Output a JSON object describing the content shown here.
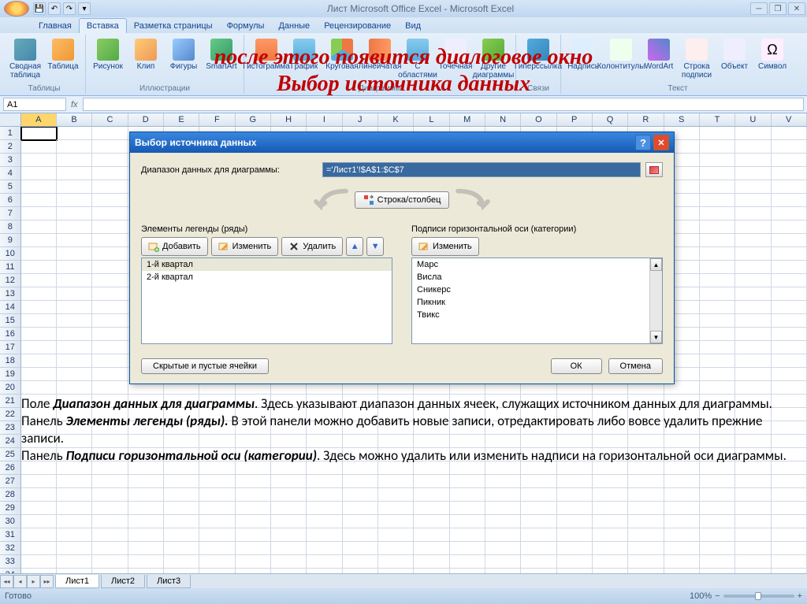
{
  "title": "Лист Microsoft Office Excel - Microsoft Excel",
  "tabs": [
    "Главная",
    "Вставка",
    "Разметка страницы",
    "Формулы",
    "Данные",
    "Рецензирование",
    "Вид"
  ],
  "ribbon_groups": {
    "tables": {
      "label": "Таблицы",
      "items": [
        "Сводная\nтаблица",
        "Таблица"
      ]
    },
    "illus": {
      "label": "Иллюстрации",
      "items": [
        "Рисунок",
        "Клип",
        "Фигуры",
        "SmartArt"
      ]
    },
    "charts": {
      "label": "Диаграммы",
      "items": [
        "Гистограмма",
        "График",
        "Круговая",
        "Линейчатая",
        "С\nобластями",
        "Точечная",
        "Другие\nдиаграммы"
      ]
    },
    "links": {
      "label": "Связи",
      "items": [
        "Гиперссылка"
      ]
    },
    "text": {
      "label": "Текст",
      "items": [
        "Надпись",
        "Колонтитулы",
        "WordArt",
        "Строка\nподписи",
        "Объект",
        "Символ"
      ]
    }
  },
  "name_box": "A1",
  "columns": [
    "A",
    "B",
    "C",
    "D",
    "E",
    "F",
    "G",
    "H",
    "I",
    "J",
    "K",
    "L",
    "M",
    "N",
    "O",
    "P",
    "Q",
    "R",
    "S",
    "T",
    "U",
    "V"
  ],
  "overlay_line1": "после этого появится диалоговое окно",
  "overlay_line2": "Выбор источника данных",
  "dialog": {
    "title": "Выбор источника данных",
    "range_label": "Диапазон данных для диаграммы:",
    "range_value": "='Лист1'!$A$1:$C$7",
    "switch_btn": "Строка/столбец",
    "left_title": "Элементы легенды (ряды)",
    "btn_add": "Добавить",
    "btn_edit": "Изменить",
    "btn_delete": "Удалить",
    "left_items": [
      "1-й квартал",
      "2-й квартал"
    ],
    "right_title": "Подписи горизонтальной оси (категории)",
    "right_items": [
      "Марс",
      "Висла",
      "Сникерс",
      "Пикник",
      "Твикс"
    ],
    "hidden_btn": "Скрытые и пустые ячейки",
    "ok": "ОК",
    "cancel": "Отмена"
  },
  "explain": {
    "p1a": "Поле ",
    "p1b": "Диапазон данных для диаграммы",
    "p1c": ". Здесь указывают диапазон данных ячеек, служащих источником данных для диаграммы.",
    "p2a": "Панель ",
    "p2b": "Элементы легенды (ряды).",
    "p2c": " В этой панели можно добавить новые записи, отредактировать либо вовсе удалить прежние записи.",
    "p3a": "Панель ",
    "p3b": "Подписи горизонтальной оси (категории)",
    "p3c": ". Здесь можно удалить или изменить надписи на горизонтальной оси диаграммы."
  },
  "sheets": [
    "Лист1",
    "Лист2",
    "Лист3"
  ],
  "status": "Готово",
  "zoom": "100%"
}
